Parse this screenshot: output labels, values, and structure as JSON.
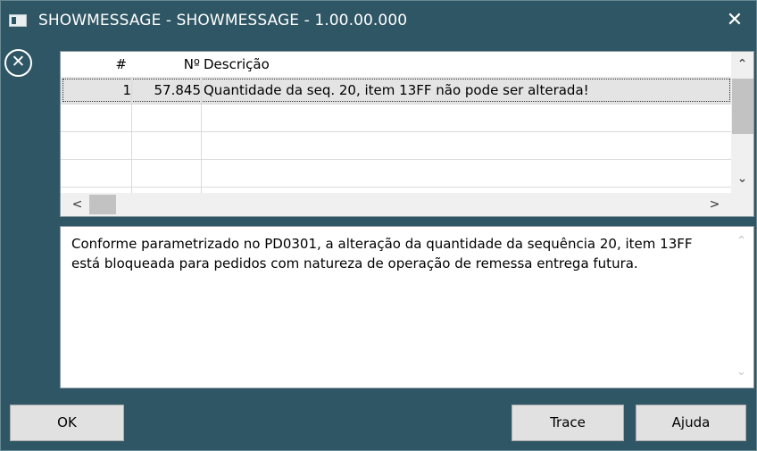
{
  "window": {
    "title": "SHOWMESSAGE - SHOWMESSAGE - 1.00.00.000",
    "close_glyph": "✕",
    "app_icon": "window-app-icon",
    "error_icon": "error-circle-x-icon",
    "error_glyph": "✕",
    "accent_color": "#2f5664"
  },
  "grid": {
    "columns": {
      "index": "#",
      "number": "Nº",
      "description": "Descrição"
    },
    "rows": [
      {
        "index": "1",
        "number": "57.845",
        "description": "Quantidade da seq. 20, item 13FF não pode ser alterada!"
      }
    ],
    "scroll_up": "⌃",
    "scroll_down": "⌄",
    "scroll_left": "<",
    "scroll_right": ">"
  },
  "detail": {
    "text": "Conforme parametrizado no PD0301, a alteração da quantidade da sequência 20, item 13FF está bloqueada para pedidos com natureza de operação de remessa entrega futura.",
    "scroll_up": "⌃",
    "scroll_down": "⌄"
  },
  "buttons": {
    "ok": "OK",
    "trace": "Trace",
    "help": "Ajuda"
  }
}
